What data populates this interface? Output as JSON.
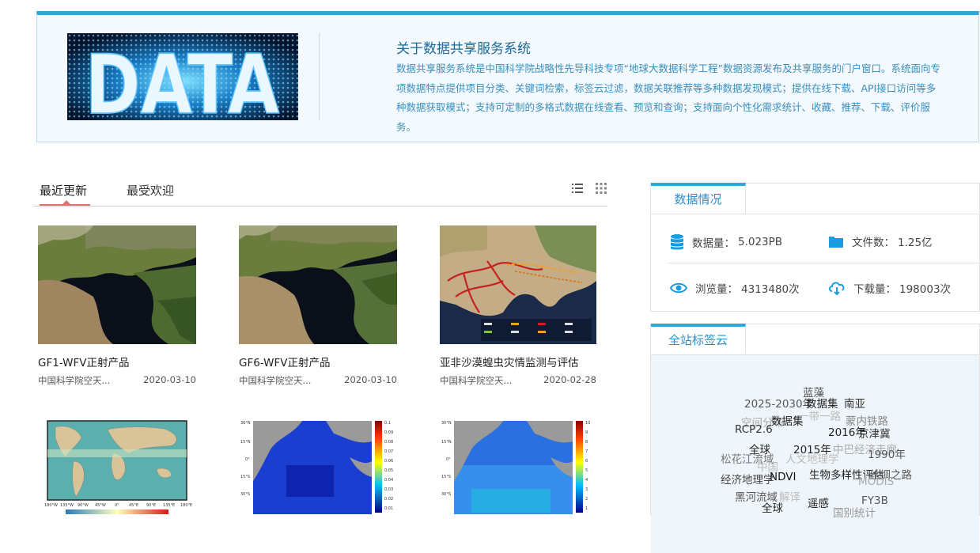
{
  "intro": {
    "image_text": "DATA",
    "title": "关于数据共享服务系统",
    "text": "数据共享服务系统是中国科学院战略性先导科技专项“地球大数据科学工程”数据资源发布及共享服务的门户窗口。系统面向专项数据特点提供项目分类、关键词检索，标签云过滤，数据关联推荐等多种数据发现模式；提供在线下载、API接口访问等多种数据获取模式；支持可定制的多格式数据在线查看、预览和查询；支持面向个性化需求统计、收藏、推荐、下载、评价服务。"
  },
  "tabs": {
    "recent": "最近更新",
    "popular": "最受欢迎"
  },
  "view_icons": [
    "list-view-icon",
    "grid-view-icon"
  ],
  "cards": [
    {
      "title": "GF1-WFV正射产品",
      "org": "中国科学院空天...",
      "date": "2020-03-10"
    },
    {
      "title": "GF6-WFV正射产品",
      "org": "中国科学院空天...",
      "date": "2020-03-10"
    },
    {
      "title": "亚非沙漠蝗虫灾情监测与评估",
      "org": "中国科学院空天...",
      "date": "2020-02-28"
    }
  ],
  "map_labels": {
    "lat_a": [
      "30°N",
      "15°N",
      "0°",
      "15°S",
      "30°S"
    ],
    "scale_a": [
      "0.1",
      "0.09",
      "0.08",
      "0.07",
      "0.06",
      "0.05",
      "0.04",
      "0.03",
      "0.02",
      "0.01"
    ],
    "scale_b": [
      "10",
      "9",
      "8",
      "7",
      "6",
      "5",
      "4",
      "3",
      "2",
      "1"
    ],
    "lon_world": [
      "180°W",
      "135°W",
      "90°W",
      "45°W",
      "0°",
      "45°E",
      "90°E",
      "135°E",
      "180°E"
    ]
  },
  "stats_panel": {
    "title": "数据情况",
    "items": [
      {
        "label": "数据量：",
        "value": "5.023PB",
        "icon": "database-icon"
      },
      {
        "label": "文件数：",
        "value": "1.25亿",
        "icon": "folder-icon"
      },
      {
        "label": "浏览量：",
        "value": "4313480次",
        "icon": "eye-icon"
      },
      {
        "label": "下载量：",
        "value": "198003次",
        "icon": "cloud-download-icon"
      }
    ]
  },
  "tag_panel": {
    "title": "全站标签云",
    "tags": [
      {
        "text": "蓝藻",
        "color": "#555555"
      },
      {
        "text": "2025-2030年",
        "color": "#555555"
      },
      {
        "text": "数据集",
        "color": "#222222"
      },
      {
        "text": "南亚",
        "color": "#333333"
      },
      {
        "text": "空间分布",
        "color": "#aaaaaa"
      },
      {
        "text": "一带一路",
        "color": "#bbbbbb"
      },
      {
        "text": "数据集",
        "color": "#222222"
      },
      {
        "text": "蒙内铁路",
        "color": "#888888"
      },
      {
        "text": "RCP2.6",
        "color": "#333333"
      },
      {
        "text": "2016年",
        "color": "#222222"
      },
      {
        "text": "京津冀",
        "color": "#333333"
      },
      {
        "text": "全球",
        "color": "#222222"
      },
      {
        "text": "2015年",
        "color": "#222222"
      },
      {
        "text": "中巴经济走廊",
        "color": "#aaaaaa"
      },
      {
        "text": "人文地理学",
        "color": "#bbbbbb"
      },
      {
        "text": "1990年",
        "color": "#555555"
      },
      {
        "text": "松花江流域",
        "color": "#777777"
      },
      {
        "text": "中国",
        "color": "#bbbbbb"
      },
      {
        "text": "生物多样性评估",
        "color": "#222222"
      },
      {
        "text": "丝绸之路",
        "color": "#555555"
      },
      {
        "text": "经济地理学",
        "color": "#444444"
      },
      {
        "text": "NDVI",
        "color": "#111111"
      },
      {
        "text": "MODIS",
        "color": "#aaaaaa"
      },
      {
        "text": "黑河流域",
        "color": "#555555"
      },
      {
        "text": "解译",
        "color": "#bbbbbb"
      },
      {
        "text": "遥感",
        "color": "#222222"
      },
      {
        "text": "FY3B",
        "color": "#555555"
      },
      {
        "text": "全球",
        "color": "#222222"
      },
      {
        "text": "国别统计",
        "color": "#999999"
      }
    ]
  },
  "colors": {
    "accent": "#27a8df",
    "active_tab": "#e27272",
    "icon_blue": "#1a9ce0"
  }
}
